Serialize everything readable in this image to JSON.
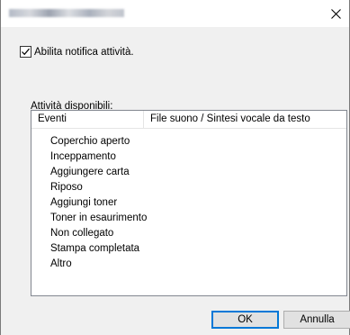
{
  "window": {
    "title_obscured": true,
    "close_icon": "close-icon"
  },
  "notify_checkbox": {
    "label": "Abilita notifica attività.",
    "checked": true
  },
  "events_list": {
    "group_label": "Attività disponibili:",
    "columns": [
      "Eventi",
      "File suono / Sintesi vocale da testo"
    ],
    "items": [
      "Coperchio aperto",
      "Inceppamento",
      "Aggiungere carta",
      "Riposo",
      "Aggiungi toner",
      "Toner in esaurimento",
      "Non collegato",
      "Stampa completata",
      "Altro"
    ]
  },
  "buttons": {
    "ok_label": "OK",
    "cancel_label": "Annulla"
  },
  "colors": {
    "dialog_bg": "#f0f0f0",
    "list_bg": "#ffffff",
    "default_button_border": "#0078d7"
  }
}
